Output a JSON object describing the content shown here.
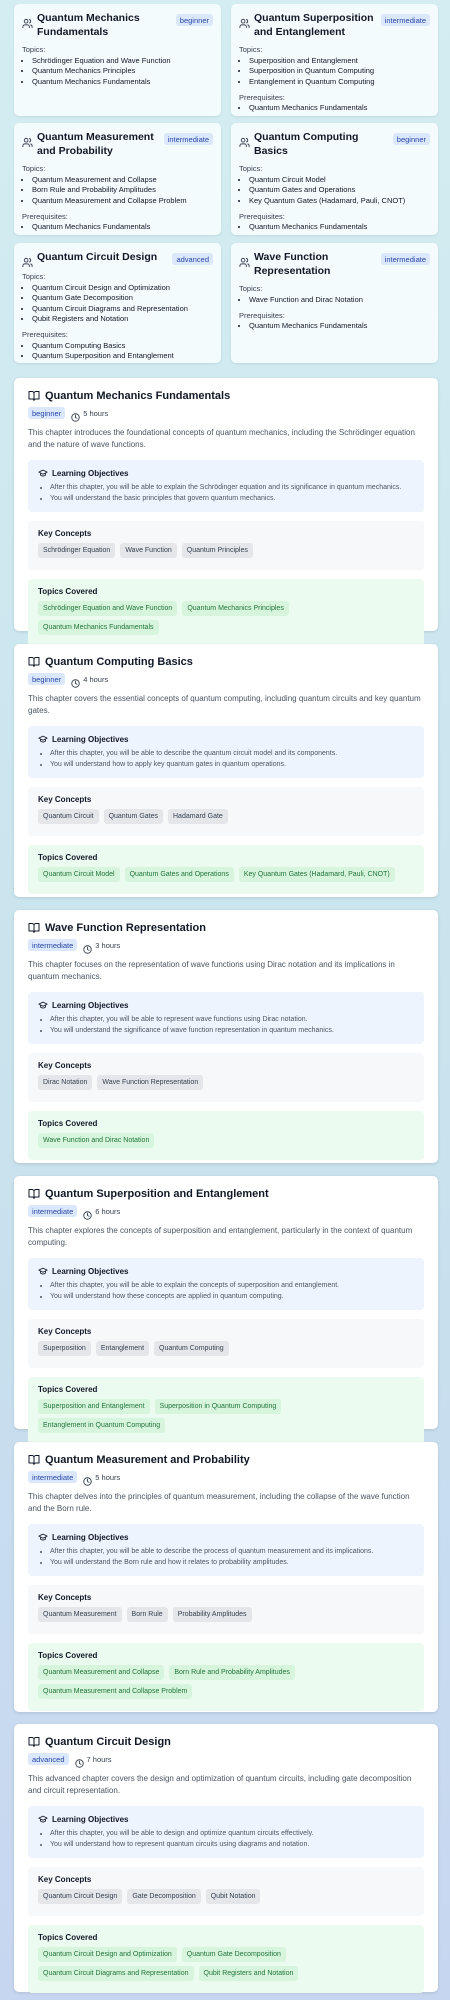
{
  "overview_cards": [
    {
      "title": "Quantum Mechanics Fundamentals",
      "level": "beginner",
      "topics_label": "Topics:",
      "topics": [
        "Schrödinger Equation and Wave Function",
        "Quantum Mechanics Principles",
        "Quantum Mechanics Fundamentals"
      ],
      "prereq_label": "",
      "prerequisites": []
    },
    {
      "title": "Quantum Superposition and Entanglement",
      "level": "intermediate",
      "topics_label": "Topics:",
      "topics": [
        "Superposition and Entanglement",
        "Superposition in Quantum Computing",
        "Entanglement in Quantum Computing"
      ],
      "prereq_label": "Prerequisites:",
      "prerequisites": [
        "Quantum Mechanics Fundamentals"
      ]
    },
    {
      "title": "Quantum Measurement and Probability",
      "level": "intermediate",
      "topics_label": "Topics:",
      "topics": [
        "Quantum Measurement and Collapse",
        "Born Rule and Probability Amplitudes",
        "Quantum Measurement and Collapse Problem"
      ],
      "prereq_label": "Prerequisites:",
      "prerequisites": [
        "Quantum Mechanics Fundamentals"
      ]
    },
    {
      "title": "Quantum Computing Basics",
      "level": "beginner",
      "topics_label": "Topics:",
      "topics": [
        "Quantum Circuit Model",
        "Quantum Gates and Operations",
        "Key Quantum Gates (Hadamard, Pauli, CNOT)"
      ],
      "prereq_label": "Prerequisites:",
      "prerequisites": [
        "Quantum Mechanics Fundamentals"
      ]
    },
    {
      "title": "Quantum Circuit Design",
      "level": "advanced",
      "topics_label": "Topics:",
      "topics": [
        "Quantum Circuit Design and Optimization",
        "Quantum Gate Decomposition",
        "Quantum Circuit Diagrams and Representation",
        "Qubit Registers and Notation"
      ],
      "prereq_label": "Prerequisites:",
      "prerequisites": [
        "Quantum Computing Basics",
        "Quantum Superposition and Entanglement"
      ]
    },
    {
      "title": "Wave Function Representation",
      "level": "intermediate",
      "topics_label": "Topics:",
      "topics": [
        "Wave Function and Dirac Notation"
      ],
      "prereq_label": "Prerequisites:",
      "prerequisites": [
        "Quantum Mechanics Fundamentals"
      ]
    }
  ],
  "labels": {
    "learning_objectives": "Learning Objectives",
    "key_concepts": "Key Concepts",
    "topics_covered": "Topics Covered"
  },
  "chapters": [
    {
      "title": "Quantum Mechanics Fundamentals",
      "level": "beginner",
      "duration": "5 hours",
      "description": "This chapter introduces the foundational concepts of quantum mechanics, including the Schrödinger equation and the nature of wave functions.",
      "objectives": [
        "After this chapter, you will be able to explain the Schrödinger equation and its significance in quantum mechanics.",
        "You will understand the basic principles that govern quantum mechanics."
      ],
      "key_concepts": [
        "Schrödinger Equation",
        "Wave Function",
        "Quantum Principles"
      ],
      "topics": [
        "Schrödinger Equation and Wave Function",
        "Quantum Mechanics Principles",
        "Quantum Mechanics Fundamentals"
      ]
    },
    {
      "title": "Quantum Computing Basics",
      "level": "beginner",
      "duration": "4 hours",
      "description": "This chapter covers the essential concepts of quantum computing, including quantum circuits and key quantum gates.",
      "objectives": [
        "After this chapter, you will be able to describe the quantum circuit model and its components.",
        "You will understand how to apply key quantum gates in quantum operations."
      ],
      "key_concepts": [
        "Quantum Circuit",
        "Quantum Gates",
        "Hadamard Gate"
      ],
      "topics": [
        "Quantum Circuit Model",
        "Quantum Gates and Operations",
        "Key Quantum Gates (Hadamard, Pauli, CNOT)"
      ]
    },
    {
      "title": "Wave Function Representation",
      "level": "intermediate",
      "duration": "3 hours",
      "description": "This chapter focuses on the representation of wave functions using Dirac notation and its implications in quantum mechanics.",
      "objectives": [
        "After this chapter, you will be able to represent wave functions using Dirac notation.",
        "You will understand the significance of wave function representation in quantum mechanics."
      ],
      "key_concepts": [
        "Dirac Notation",
        "Wave Function Representation"
      ],
      "topics": [
        "Wave Function and Dirac Notation"
      ]
    },
    {
      "title": "Quantum Superposition and Entanglement",
      "level": "intermediate",
      "duration": "6 hours",
      "description": "This chapter explores the concepts of superposition and entanglement, particularly in the context of quantum computing.",
      "objectives": [
        "After this chapter, you will be able to explain the concepts of superposition and entanglement.",
        "You will understand how these concepts are applied in quantum computing."
      ],
      "key_concepts": [
        "Superposition",
        "Entanglement",
        "Quantum Computing"
      ],
      "topics": [
        "Superposition and Entanglement",
        "Superposition in Quantum Computing",
        "Entanglement in Quantum Computing"
      ]
    },
    {
      "title": "Quantum Measurement and Probability",
      "level": "intermediate",
      "duration": "5 hours",
      "description": "This chapter delves into the principles of quantum measurement, including the collapse of the wave function and the Born rule.",
      "objectives": [
        "After this chapter, you will be able to describe the process of quantum measurement and its implications.",
        "You will understand the Born rule and how it relates to probability amplitudes."
      ],
      "key_concepts": [
        "Quantum Measurement",
        "Born Rule",
        "Probability Amplitudes"
      ],
      "topics": [
        "Quantum Measurement and Collapse",
        "Born Rule and Probability Amplitudes",
        "Quantum Measurement and Collapse Problem"
      ]
    },
    {
      "title": "Quantum Circuit Design",
      "level": "advanced",
      "duration": "7 hours",
      "description": "This advanced chapter covers the design and optimization of quantum circuits, including gate decomposition and circuit representation.",
      "objectives": [
        "After this chapter, you will be able to design and optimize quantum circuits effectively.",
        "You will understand how to represent quantum circuits using diagrams and notation."
      ],
      "key_concepts": [
        "Quantum Circuit Design",
        "Gate Decomposition",
        "Qubit Notation"
      ],
      "topics": [
        "Quantum Circuit Design and Optimization",
        "Quantum Gate Decomposition",
        "Quantum Circuit Diagrams and Representation",
        "Qubit Registers and Notation"
      ]
    }
  ]
}
